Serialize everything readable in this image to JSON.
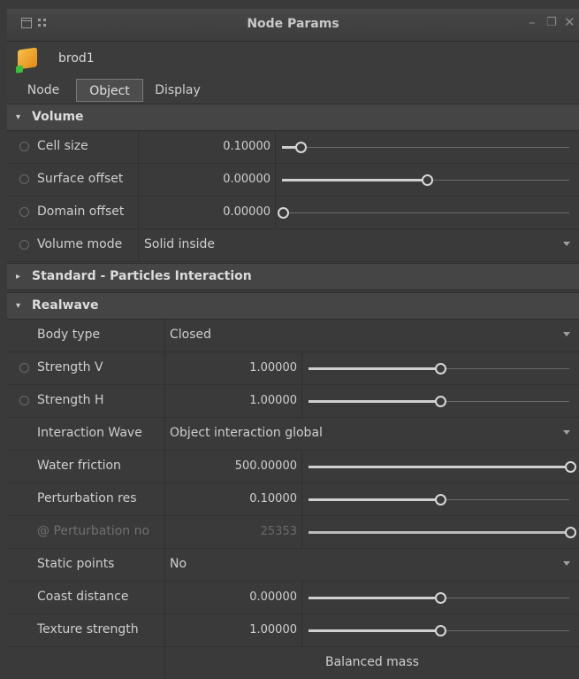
{
  "window": {
    "title": "Node Params"
  },
  "node": {
    "name": "brod1"
  },
  "tabs": [
    {
      "label": "Node",
      "active": false
    },
    {
      "label": "Object",
      "active": true
    },
    {
      "label": "Display",
      "active": false
    }
  ],
  "sections": {
    "volume": {
      "label": "Volume",
      "expanded": true
    },
    "standard": {
      "label": "Standard - Particles Interaction",
      "expanded": false
    },
    "realwave": {
      "label": "Realwave",
      "expanded": true
    }
  },
  "volume_params": {
    "cell_size": {
      "label": "Cell size",
      "value": "0.10000",
      "slider": 0.06
    },
    "surface_offset": {
      "label": "Surface offset",
      "value": "0.00000",
      "slider": 0.5
    },
    "domain_offset": {
      "label": "Domain offset",
      "value": "0.00000",
      "slider": 0.0
    },
    "volume_mode": {
      "label": "Volume mode",
      "value": "Solid inside"
    }
  },
  "realwave_params": {
    "body_type": {
      "label": "Body type",
      "value": "Closed"
    },
    "strength_v": {
      "label": "Strength V",
      "value": "1.00000",
      "slider": 0.5
    },
    "strength_h": {
      "label": "Strength H",
      "value": "1.00000",
      "slider": 0.5
    },
    "interaction_wave": {
      "label": "Interaction Wave",
      "value": "Object interaction global"
    },
    "water_friction": {
      "label": "Water friction",
      "value": "500.00000",
      "slider": 1.0
    },
    "perturbation_res": {
      "label": "Perturbation res",
      "value": "0.10000",
      "slider": 0.5
    },
    "perturbation_no": {
      "label": "@ Perturbation no",
      "value": "25353",
      "slider": 1.0,
      "disabled": true
    },
    "static_points": {
      "label": "Static points",
      "value": "No"
    },
    "coast_distance": {
      "label": "Coast distance",
      "value": "0.00000",
      "slider": 0.5
    },
    "texture_strength": {
      "label": "Texture strength",
      "value": "1.00000",
      "slider": 0.5
    },
    "balanced_mass": {
      "label": "Balanced mass"
    }
  }
}
